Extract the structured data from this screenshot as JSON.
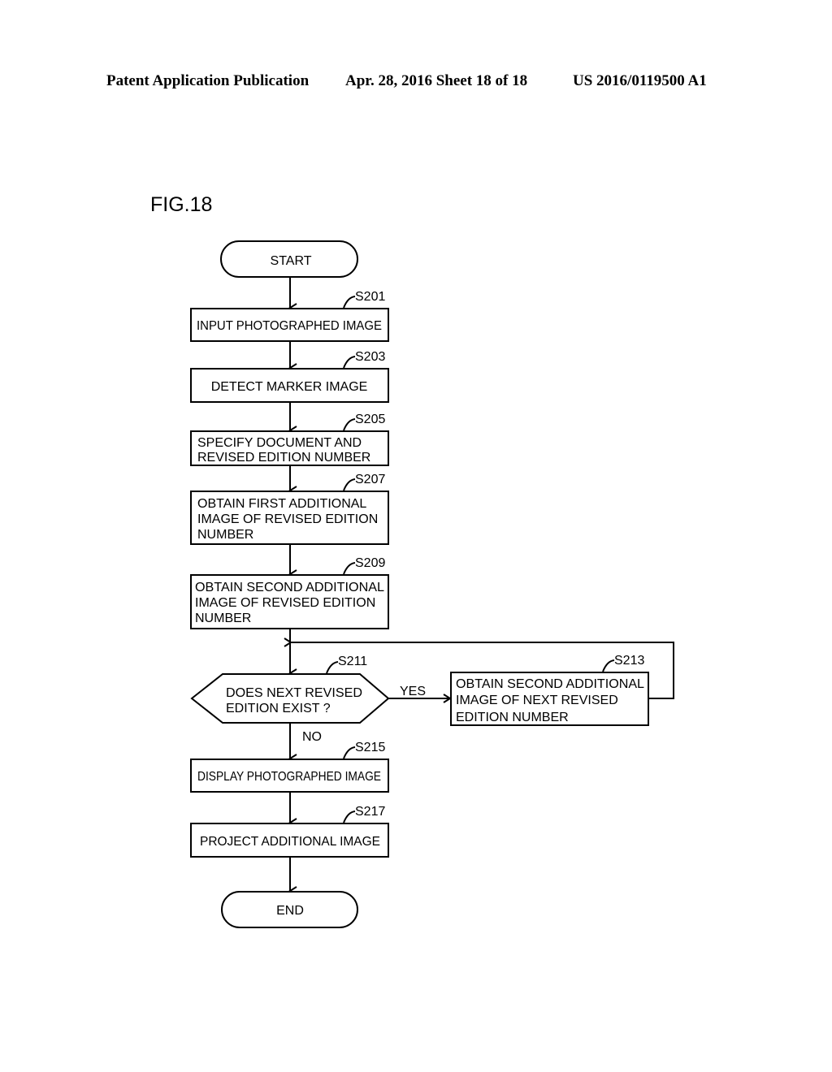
{
  "header": {
    "publication": "Patent Application Publication",
    "date_sheet": "Apr. 28, 2016  Sheet 18 of 18",
    "number": "US 2016/0119500 A1"
  },
  "figure": {
    "title": "FIG.18",
    "terminals": {
      "start": "START",
      "end": "END"
    },
    "steps": [
      {
        "id": "S201",
        "lines": [
          "INPUT PHOTOGRAPHED IMAGE"
        ]
      },
      {
        "id": "S203",
        "lines": [
          "DETECT MARKER IMAGE"
        ]
      },
      {
        "id": "S205",
        "lines": [
          "SPECIFY DOCUMENT AND",
          "REVISED EDITION NUMBER"
        ]
      },
      {
        "id": "S207",
        "lines": [
          "OBTAIN FIRST ADDITIONAL",
          "IMAGE OF REVISED EDITION",
          "NUMBER"
        ]
      },
      {
        "id": "S209",
        "lines": [
          "OBTAIN SECOND ADDITIONAL",
          "IMAGE OF REVISED EDITION",
          "NUMBER"
        ]
      },
      {
        "id": "S211",
        "lines": [
          "DOES NEXT REVISED",
          "EDITION EXIST ?"
        ]
      },
      {
        "id": "S213",
        "lines": [
          "OBTAIN SECOND ADDITIONAL",
          "IMAGE OF NEXT REVISED",
          "EDITION NUMBER"
        ]
      },
      {
        "id": "S215",
        "lines": [
          "DISPLAY PHOTOGRAPHED IMAGE"
        ]
      },
      {
        "id": "S217",
        "lines": [
          "PROJECT ADDITIONAL IMAGE"
        ]
      }
    ],
    "branches": {
      "yes": "YES",
      "no": "NO"
    }
  }
}
